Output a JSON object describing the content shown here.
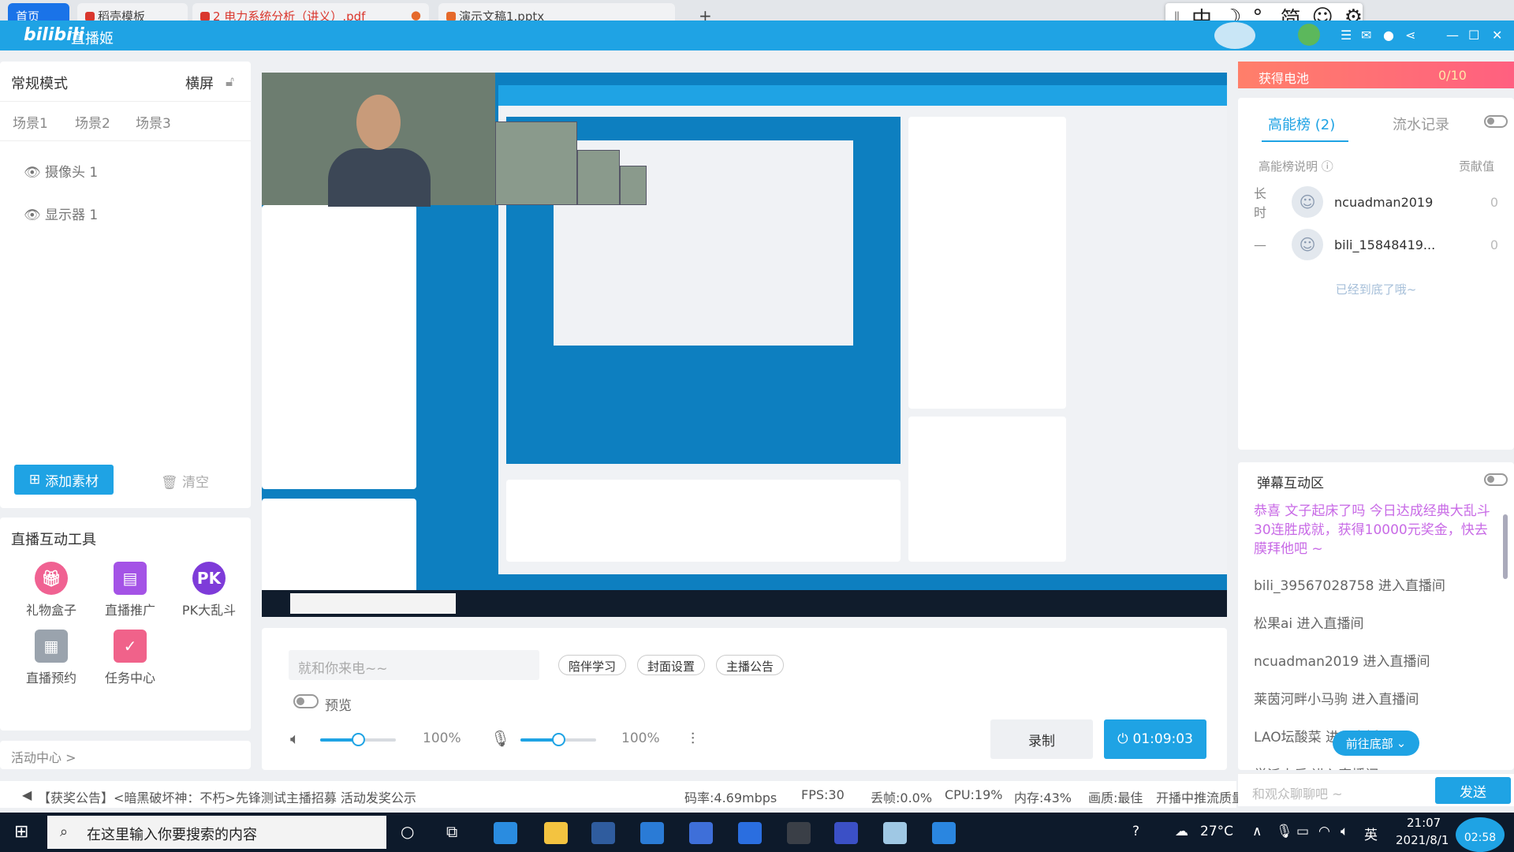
{
  "browser_tabs": [
    {
      "label": "首页",
      "color": "#1a73e8"
    },
    {
      "label": "稻壳模板",
      "color": "#d9372e"
    },
    {
      "label": "2 电力系统分析（讲义）.pdf",
      "color": "#d9372e"
    },
    {
      "label": "演示文稿1.pptx",
      "color": "#e5692b"
    }
  ],
  "new_tab_symbol": "+",
  "ime": {
    "mode": "中",
    "moon": "☽",
    "punct": "°,",
    "simp": "简",
    "emoji": "☺",
    "gear": "⚙"
  },
  "app": {
    "logo": "bilibili",
    "title": "直播姬"
  },
  "left_panel": {
    "mode": "常规模式",
    "orientation": "横屏",
    "scenes": [
      "场景1",
      "场景2",
      "场景3"
    ],
    "sources": [
      "摄像头 1",
      "显示器 1"
    ],
    "add_button": "添加素材",
    "clear_button": "清空"
  },
  "tools": {
    "title": "直播互动工具",
    "items": [
      {
        "label": "礼物盒子",
        "icon": "gift-box-icon",
        "color": "#f06292"
      },
      {
        "label": "直播推广",
        "icon": "promotion-icon",
        "color": "#a453e6"
      },
      {
        "label": "PK大乱斗",
        "icon": "pk-icon",
        "color": "#7e3bd9"
      },
      {
        "label": "直播预约",
        "icon": "reservation-icon",
        "color": "#9aa3ad"
      },
      {
        "label": "任务中心",
        "icon": "task-icon",
        "color": "#f0628a"
      }
    ]
  },
  "activity": "活动中心 >",
  "control": {
    "title_placeholder": "就和你来电~~",
    "pills": [
      "陪伴学习",
      "封面设置",
      "主播公告"
    ],
    "preview_label": "预览",
    "speaker_volume": "100%",
    "speaker_level": 0.5,
    "mic_volume": "100%",
    "mic_level": 0.5,
    "record": "录制",
    "live_timer": "01:09:03"
  },
  "status": {
    "announcement": "【获奖公告】<暗黑破坏神：不朽>先锋测试主播招募 活动发奖公示",
    "bitrate": "码率:4.69mbps",
    "fps": "FPS:30",
    "drop": "丢帧:0.0%",
    "cpu": "CPU:19%",
    "mem": "内存:43%",
    "quality": "画质:最佳",
    "state": "开播中",
    "push": "推流质量"
  },
  "battery": {
    "label": "获得电池",
    "count": "0/10"
  },
  "rank": {
    "tab_active": "高能榜 (2)",
    "tab_other": "流水记录",
    "desc": "高能榜说明",
    "contrib": "贡献值",
    "rows": [
      {
        "tag": "长时",
        "name": "ncuadman2019",
        "value": "0"
      },
      {
        "tag": "—",
        "name": "bili_15848419...",
        "value": "0"
      }
    ],
    "end": "已经到底了哦~"
  },
  "danmu": {
    "title": "弹幕互动区",
    "highlight": "恭喜 文子起床了吗 今日达成经典大乱斗30连胜成就，获得10000元奖金，快去膜拜他吧 ~",
    "entries": [
      "bili_39567028758 进入直播间",
      "松果ai 进入直播间",
      "ncuadman2019 进入直播间",
      "莱茵河畔小马驹 进入直播间",
      "LAO坛酸菜 进入直播间",
      "学派小乐 进入直播间"
    ],
    "jump": "前往底部",
    "input_placeholder": "和观众聊聊吧 ~",
    "send": "发送"
  },
  "taskbar": {
    "search": "在这里输入你要搜索的内容",
    "weather": "27°C",
    "ime": "英",
    "time": "21:07",
    "date": "2021/8/1",
    "live": "02:58"
  }
}
